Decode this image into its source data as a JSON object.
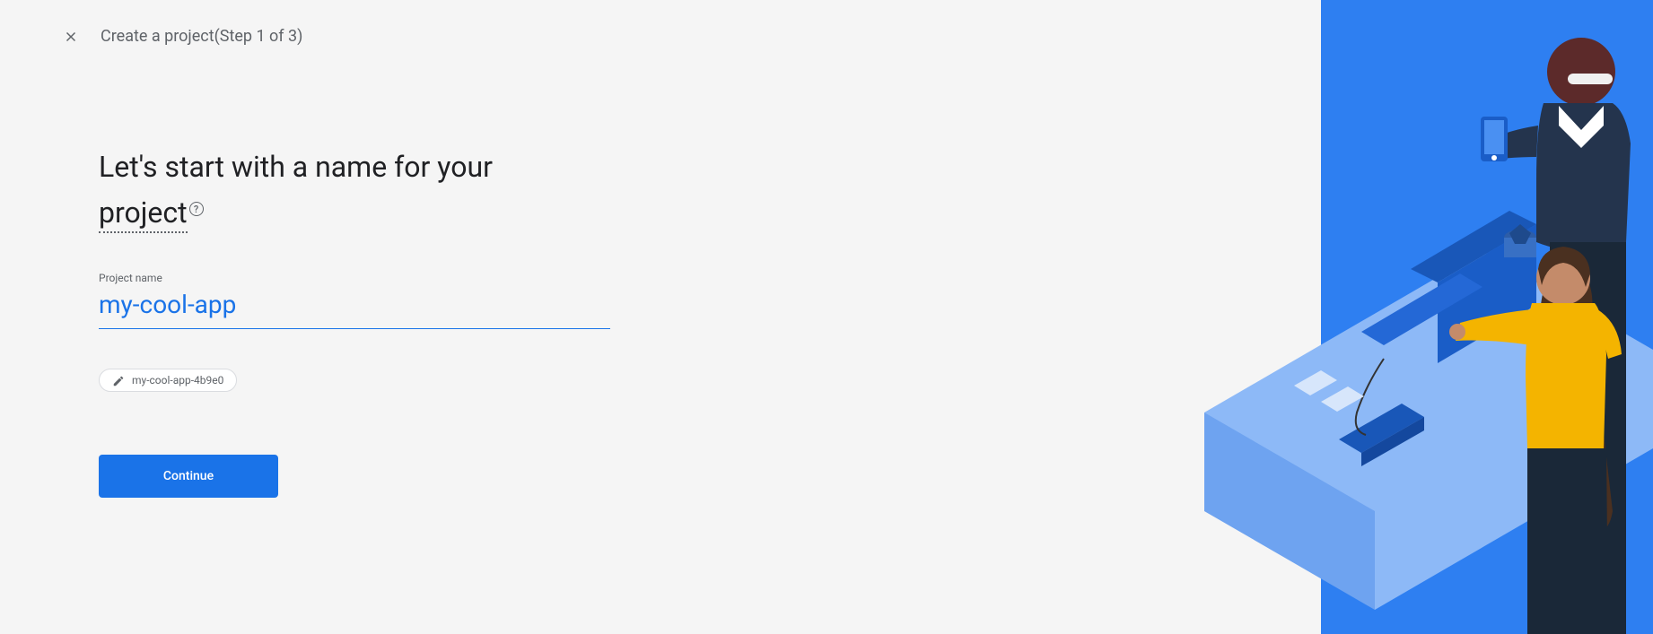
{
  "header": {
    "title": "Create a project(Step 1 of 3)"
  },
  "main": {
    "heading_part1": "Let's start with a name for your ",
    "heading_underlined": "project",
    "input_label": "Project name",
    "input_value": "my-cool-app",
    "chip_text": "my-cool-app-4b9e0",
    "continue_label": "Continue"
  }
}
